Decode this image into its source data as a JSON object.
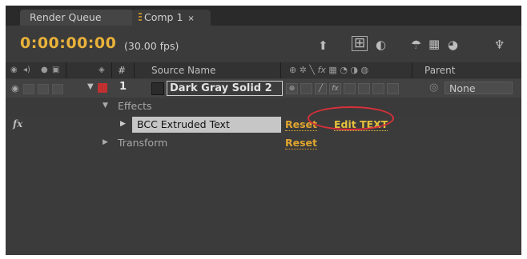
{
  "tabs": [
    {
      "label": "Render Queue"
    },
    {
      "label": "Comp 1",
      "close": "×"
    }
  ],
  "header": {
    "timecode": "0:00:00:00",
    "fps": "(30.00 fps)"
  },
  "columns": {
    "number": "#",
    "source_name": "Source Name",
    "parent": "Parent"
  },
  "layer": {
    "number": "1",
    "name": "Dark Gray Solid 2",
    "parent": "None",
    "label_color": "#c03030"
  },
  "effects": {
    "group_label": "Effects",
    "effect": {
      "icon": "fx",
      "name": "BCC Extruded Text",
      "reset": "Reset",
      "edit": "Edit TEXT"
    },
    "transform": {
      "label": "Transform",
      "reset": "Reset"
    }
  },
  "colors": {
    "accent": "#e9b23a",
    "highlight": "#d9303a",
    "panel": "#3b3b3b"
  }
}
